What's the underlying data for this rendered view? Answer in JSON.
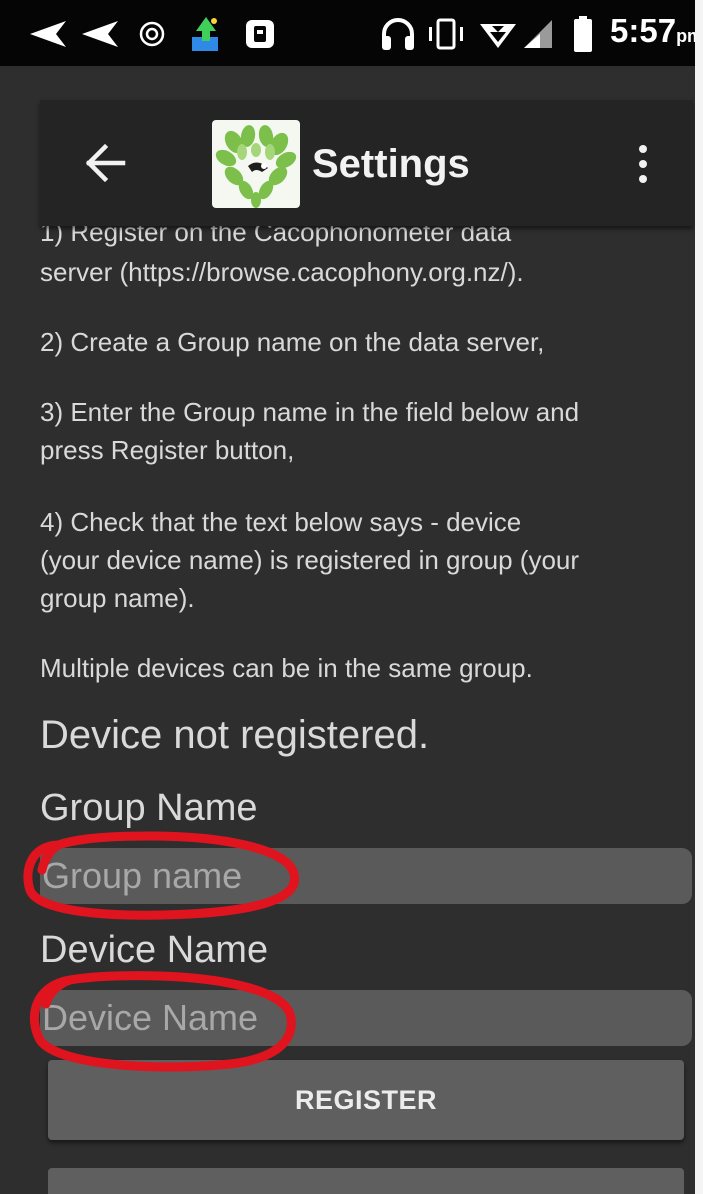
{
  "status_bar": {
    "time": "5:57",
    "ampm": "pm"
  },
  "app_bar": {
    "title": "Settings"
  },
  "instructions": {
    "step1_line1": "1) Register on the Cacophonometer data",
    "step1_line2": "server (https://browse.cacophony.org.nz/).",
    "step2": "2) Create a Group name on the data server,",
    "step3_line1": "3) Enter the Group name in the field below and",
    "step3_line2": "press Register button,",
    "step4_line1": "4) Check that the text below says - device",
    "step4_line2": "(your device name) is registered in group (your",
    "step4_line3": "group name).",
    "note": "Multiple devices can be in the same group."
  },
  "registration_status": "Device not registered.",
  "group": {
    "label": "Group Name",
    "value": "",
    "placeholder": "Group name"
  },
  "device": {
    "label": "Device Name",
    "value": "",
    "placeholder": "Device Name"
  },
  "register_button_label": "REGISTER",
  "colors": {
    "background": "#2e2e2e",
    "app_bar": "#242424",
    "input": "#5a5a5a",
    "button": "#5f5f5f",
    "annotation": "#e0141e"
  }
}
